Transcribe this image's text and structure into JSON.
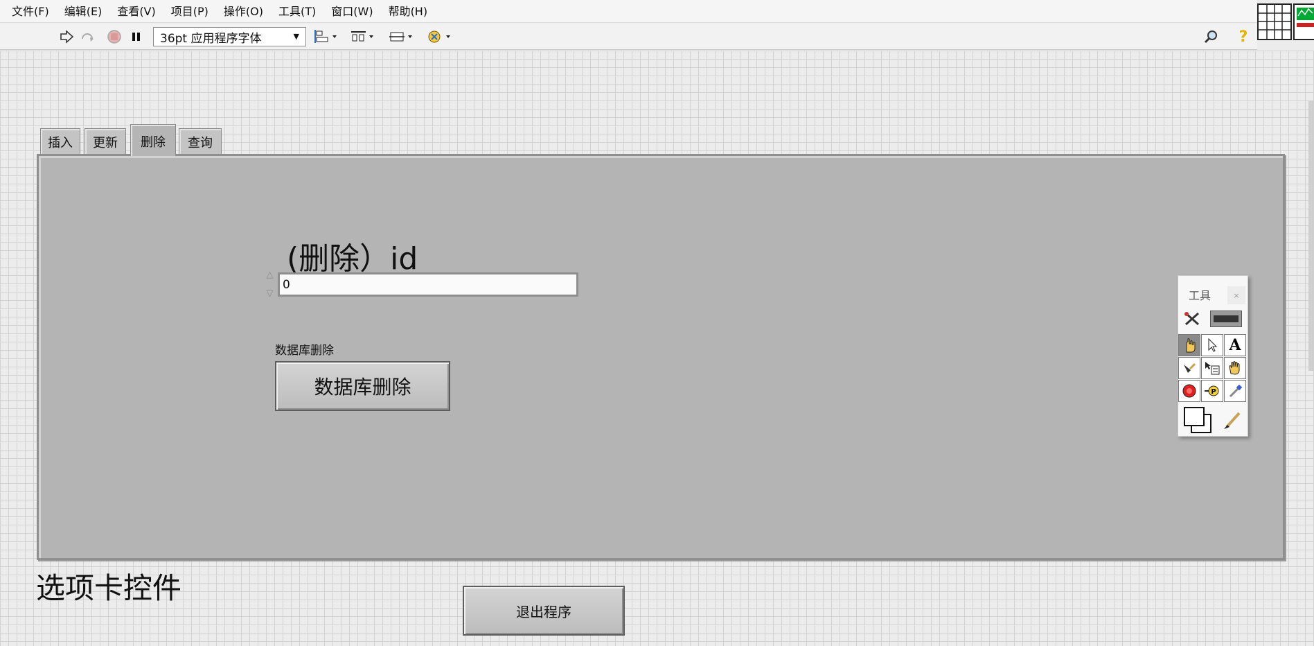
{
  "menu": [
    "文件(F)",
    "编辑(E)",
    "查看(V)",
    "项目(P)",
    "操作(O)",
    "工具(T)",
    "窗口(W)",
    "帮助(H)"
  ],
  "toolbar": {
    "font_select": "36pt 应用程序字体",
    "icons": [
      "run-arrow-icon",
      "run-continuously-icon",
      "abort-icon",
      "pause-icon",
      "align-objects-icon",
      "distribute-objects-icon",
      "resize-objects-icon",
      "reorder-icon",
      "search-icon",
      "help-icon"
    ]
  },
  "tabs": [
    "插入",
    "更新",
    "删除",
    "查询"
  ],
  "active_tab": 2,
  "delete_page": {
    "id_label": "(删除）id",
    "id_value": "0",
    "button_caption": "数据库删除",
    "button_text": "数据库删除"
  },
  "tab_control_caption": "选项卡控件",
  "exit_button": "退出程序",
  "tools_palette": {
    "title": "工具",
    "close": "×",
    "tools": [
      "auto-tool-icon",
      "operate-value-icon",
      "position-select-icon",
      "edit-text-icon",
      "connect-wire-icon",
      "object-shortcut-menu-icon",
      "scroll-window-icon",
      "breakpoint-icon",
      "probe-icon",
      "get-color-icon",
      "set-color-icon"
    ]
  },
  "colors": {
    "panel_grid": "#ececec",
    "tab_body": "#b4b4b4",
    "toolbar": "#f2f2f2"
  }
}
